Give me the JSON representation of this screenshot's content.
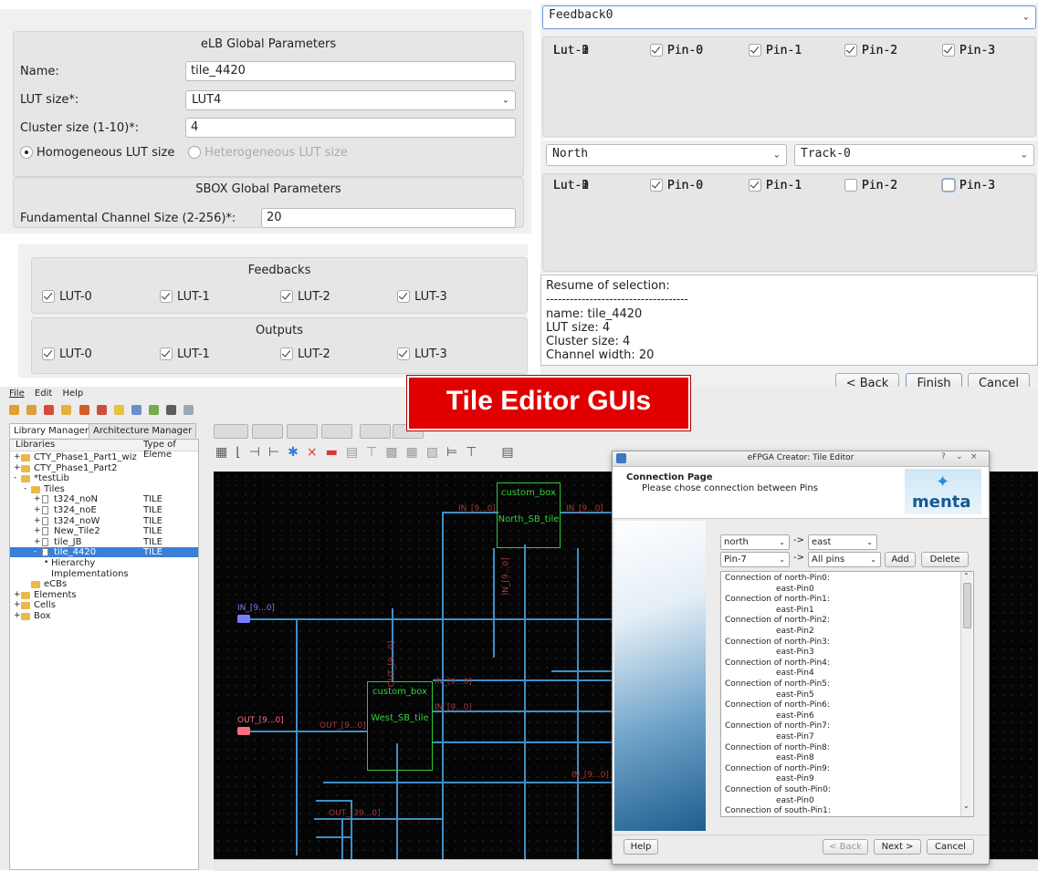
{
  "elb": {
    "title": "eLB Global Parameters",
    "name_label": "Name:",
    "name_value": "tile_4420",
    "lut_label": "LUT size*:",
    "lut_value": "LUT4",
    "cluster_label": "Cluster size (1-10)*:",
    "cluster_value": "4",
    "radio_homo": "Homogeneous LUT size",
    "radio_hetero": "Heterogeneous LUT size"
  },
  "sbox": {
    "title": "SBOX Global Parameters",
    "channel_label": "Fundamental Channel Size (2-256)*:",
    "channel_value": "20"
  },
  "feedbacks": {
    "title": "Feedbacks",
    "items": [
      "LUT-0",
      "LUT-1",
      "LUT-2",
      "LUT-3"
    ],
    "checked": [
      true,
      true,
      true,
      true
    ]
  },
  "outputs": {
    "title": "Outputs",
    "items": [
      "LUT-0",
      "LUT-1",
      "LUT-2",
      "LUT-3"
    ],
    "checked": [
      true,
      true,
      true,
      true
    ]
  },
  "feedback_panel": {
    "select": "Feedback0",
    "rows": [
      {
        "lut": "Lut-0",
        "pins": [
          "Pin-0",
          "Pin-1",
          "Pin-2",
          "Pin-3"
        ],
        "checked": [
          true,
          true,
          true,
          true
        ]
      },
      {
        "lut": "Lut-1",
        "pins": [
          "Pin-0",
          "Pin-1",
          "Pin-2",
          "Pin-3"
        ],
        "checked": [
          true,
          true,
          true,
          true
        ]
      },
      {
        "lut": "Lut-2",
        "pins": [
          "Pin-0",
          "Pin-1",
          "Pin-2",
          "Pin-3"
        ],
        "checked": [
          true,
          true,
          true,
          true
        ]
      },
      {
        "lut": "Lut-3",
        "pins": [
          "Pin-0",
          "Pin-1",
          "Pin-2",
          "Pin-3"
        ],
        "checked": [
          true,
          true,
          true,
          true
        ]
      }
    ]
  },
  "track_panel": {
    "direction": "North",
    "track": "Track-0",
    "rows": [
      {
        "lut": "Lut-0",
        "pins": [
          "Pin-0",
          "Pin-1",
          "Pin-2",
          "Pin-3"
        ],
        "checked": [
          true,
          true,
          false,
          true
        ]
      },
      {
        "lut": "Lut-1",
        "pins": [
          "Pin-0",
          "Pin-1",
          "Pin-2",
          "Pin-3"
        ],
        "checked": [
          true,
          false,
          true,
          false
        ]
      },
      {
        "lut": "Lut-2",
        "pins": [
          "Pin-0",
          "Pin-1",
          "Pin-2",
          "Pin-3"
        ],
        "checked": [
          true,
          false,
          true,
          true
        ]
      },
      {
        "lut": "Lut-3",
        "pins": [
          "Pin-0",
          "Pin-1",
          "Pin-2",
          "Pin-3"
        ],
        "checked": [
          true,
          true,
          false,
          false
        ]
      }
    ]
  },
  "resume": {
    "heading": "Resume of selection:",
    "separator": "------------------------------------",
    "lines": [
      "name: tile_4420",
      "LUT size: 4",
      "Cluster size: 4",
      "Channel width: 20"
    ]
  },
  "wizard_buttons": {
    "back": "< Back",
    "finish": "Finish",
    "cancel": "Cancel"
  },
  "banner": {
    "text": "Tile Editor GUIs",
    "bg": "#e00000"
  },
  "app": {
    "menu": [
      "File",
      "Edit",
      "Help"
    ],
    "tabs": [
      "Library Manager",
      "Architecture Manager"
    ],
    "tree_header": [
      "Libraries",
      "Type of Eleme"
    ],
    "tree": [
      {
        "indent": 0,
        "exp": "+",
        "icon": "folder-icon",
        "label": "CTY_Phase1_Part1_wiz",
        "type": ""
      },
      {
        "indent": 0,
        "exp": "+",
        "icon": "folder-icon",
        "label": "CTY_Phase1_Part2",
        "type": ""
      },
      {
        "indent": 0,
        "exp": "-",
        "icon": "folder-icon",
        "label": "*testLib",
        "type": ""
      },
      {
        "indent": 1,
        "exp": "-",
        "icon": "folder-icon",
        "label": "Tiles",
        "type": ""
      },
      {
        "indent": 2,
        "exp": "+",
        "icon": "file-icon",
        "label": "t324_noN",
        "type": "TILE"
      },
      {
        "indent": 2,
        "exp": "+",
        "icon": "file-icon",
        "label": "t324_noE",
        "type": "TILE"
      },
      {
        "indent": 2,
        "exp": "+",
        "icon": "file-icon",
        "label": "t324_noW",
        "type": "TILE"
      },
      {
        "indent": 2,
        "exp": "+",
        "icon": "file-icon",
        "label": "New_Tile2",
        "type": "TILE"
      },
      {
        "indent": 2,
        "exp": "+",
        "icon": "file-icon",
        "label": "tile_JB",
        "type": "TILE"
      },
      {
        "indent": 2,
        "exp": "-",
        "icon": "file-icon",
        "label": "tile_4420",
        "type": "TILE",
        "selected": true
      },
      {
        "indent": 3,
        "exp": "•",
        "icon": "",
        "label": "Hierarchy",
        "type": ""
      },
      {
        "indent": 3,
        "exp": "",
        "icon": "",
        "label": "Implementations",
        "type": ""
      },
      {
        "indent": 1,
        "exp": "",
        "icon": "folder-icon",
        "label": "eCBs",
        "type": ""
      },
      {
        "indent": 0,
        "exp": "+",
        "icon": "folder-icon",
        "label": "Elements",
        "type": ""
      },
      {
        "indent": 0,
        "exp": "+",
        "icon": "folder-icon",
        "label": "Cells",
        "type": ""
      },
      {
        "indent": 0,
        "exp": "+",
        "icon": "folder-icon",
        "label": "Box",
        "type": ""
      }
    ],
    "schematic": {
      "north_box": {
        "title": "custom_box",
        "name": "North_SB_tile"
      },
      "west_box": {
        "title": "custom_box",
        "name": "West_SB_tile"
      },
      "in_port": "IN_[9...0]",
      "out_port": "OUT_[9...0]",
      "labels": [
        "IN_[9...0]",
        "IN_[9...0]",
        "IN_[9...0]",
        "OUT_[9...0]",
        "IN_[9...0]",
        "IN_[9...0]",
        "OUT_[9...0]",
        "OUT_[39...0]",
        "IN_[9...0]"
      ]
    }
  },
  "dialog": {
    "title": "eFPGA Creator: Tile Editor",
    "page_title": "Connection Page",
    "page_subtitle": "Please chose connection between Pins",
    "logo": "menta",
    "from_dir": "north",
    "to_dir": "east",
    "from_pin": "Pin-7",
    "to_pin": "All pins",
    "arrow": "->",
    "add": "Add",
    "delete": "Delete",
    "connections": [
      [
        "Connection of north-Pin0:",
        "east-Pin0"
      ],
      [
        "Connection of north-Pin1:",
        "east-Pin1"
      ],
      [
        "Connection of north-Pin2:",
        "east-Pin2"
      ],
      [
        "Connection of north-Pin3:",
        "east-Pin3"
      ],
      [
        "Connection of north-Pin4:",
        "east-Pin4"
      ],
      [
        "Connection of north-Pin5:",
        "east-Pin5"
      ],
      [
        "Connection of north-Pin6:",
        "east-Pin6"
      ],
      [
        "Connection of north-Pin7:",
        "east-Pin7"
      ],
      [
        "Connection of north-Pin8:",
        "east-Pin8"
      ],
      [
        "Connection of north-Pin9:",
        "east-Pin9"
      ],
      [
        "Connection of south-Pin0:",
        "east-Pin0"
      ],
      [
        "Connection of south-Pin1:",
        ""
      ]
    ],
    "help": "Help",
    "back": "< Back",
    "next": "Next >",
    "cancel": "Cancel"
  }
}
